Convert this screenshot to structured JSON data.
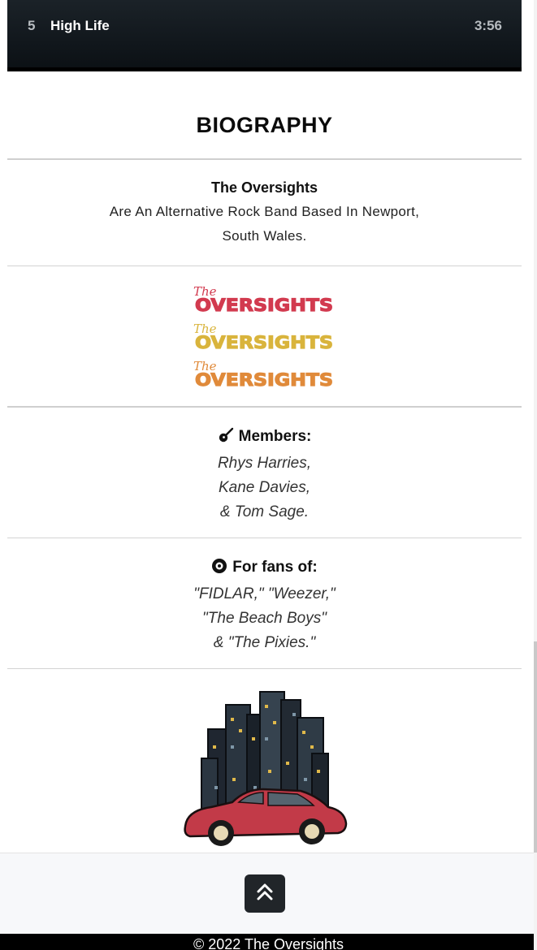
{
  "track": {
    "number": "5",
    "title": "High Life",
    "duration": "3:56"
  },
  "biography": {
    "heading": "BIOGRAPHY",
    "band_name": "The Oversights",
    "description_line1": "Are An Alternative Rock Band Based In Newport,",
    "description_line2": "South Wales."
  },
  "logos": [
    {
      "script": "The",
      "word": "OVERSIGHTS",
      "color": "#d23a4f"
    },
    {
      "script": "The",
      "word": "OVERSIGHTS",
      "color": "#d9b43c"
    },
    {
      "script": "The",
      "word": "OVERSIGHTS",
      "color": "#e08a3a"
    }
  ],
  "members": {
    "icon": "guitar-icon",
    "heading": "Members:",
    "lines": [
      "Rhys Harries,",
      "Kane Davies,",
      "& Tom Sage."
    ]
  },
  "fans_of": {
    "icon": "vinyl-record-icon",
    "heading": "For fans of:",
    "lines": [
      "\"FIDLAR,\" \"Weezer,\"",
      "\"The Beach Boys\"",
      "& \"The Pixies.\""
    ]
  },
  "illustration": {
    "icon": "city-car-illustration"
  },
  "footer": {
    "back_to_top_icon": "double-chevron-up-icon",
    "copyright": "© 2022 The Oversights"
  },
  "colors": {
    "accent_red": "#d23a4f",
    "accent_yellow": "#d9b43c",
    "accent_orange": "#e08a3a",
    "dark": "#212529"
  }
}
